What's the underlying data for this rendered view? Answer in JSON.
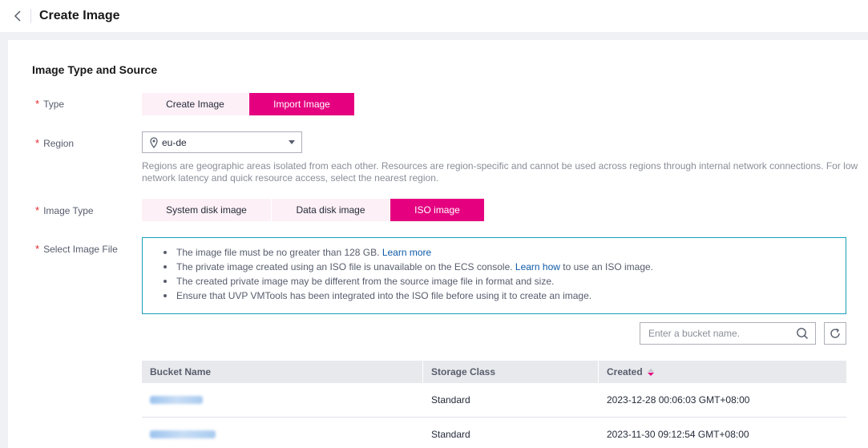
{
  "header": {
    "title": "Create Image"
  },
  "section": {
    "title": "Image Type and Source"
  },
  "type": {
    "label": "Type",
    "options": [
      "Create Image",
      "Import Image"
    ],
    "selected": "Import Image"
  },
  "region": {
    "label": "Region",
    "value": "eu-de",
    "help": "Regions are geographic areas isolated from each other. Resources are region-specific and cannot be used across regions through internal network connections. For low network latency and quick resource access, select the nearest region."
  },
  "image_type": {
    "label": "Image Type",
    "options": [
      "System disk image",
      "Data disk image",
      "ISO image"
    ],
    "selected": "ISO image"
  },
  "image_file": {
    "label": "Select Image File",
    "notes": [
      {
        "text": "The image file must be no greater than 128 GB. ",
        "link": "Learn more",
        "after": ""
      },
      {
        "text": "The private image created using an ISO file is unavailable on the ECS console. ",
        "link": "Learn how",
        "after": " to use an ISO image."
      },
      {
        "text": "The created private image may be different from the source image file in format and size.",
        "link": "",
        "after": ""
      },
      {
        "text": "Ensure that UVP VMTools has been integrated into the ISO file before using it to create an image.",
        "link": "",
        "after": ""
      }
    ]
  },
  "search": {
    "placeholder": "Enter a bucket name."
  },
  "table": {
    "columns": [
      "Bucket Name",
      "Storage Class",
      "Created"
    ],
    "rows": [
      {
        "storage_class": "Standard",
        "created": "2023-12-28 00:06:03 GMT+08:00"
      },
      {
        "storage_class": "Standard",
        "created": "2023-11-30 09:12:54 GMT+08:00"
      }
    ]
  },
  "icons": {
    "back": "chevron-left-icon",
    "region": "location-pin-icon",
    "search": "search-icon",
    "refresh": "refresh-icon",
    "sort": "sort-icon"
  },
  "colors": {
    "accent": "#e4007f",
    "info_border": "#17a2b8",
    "link": "#0e5aa8",
    "required": "#e6262f"
  }
}
